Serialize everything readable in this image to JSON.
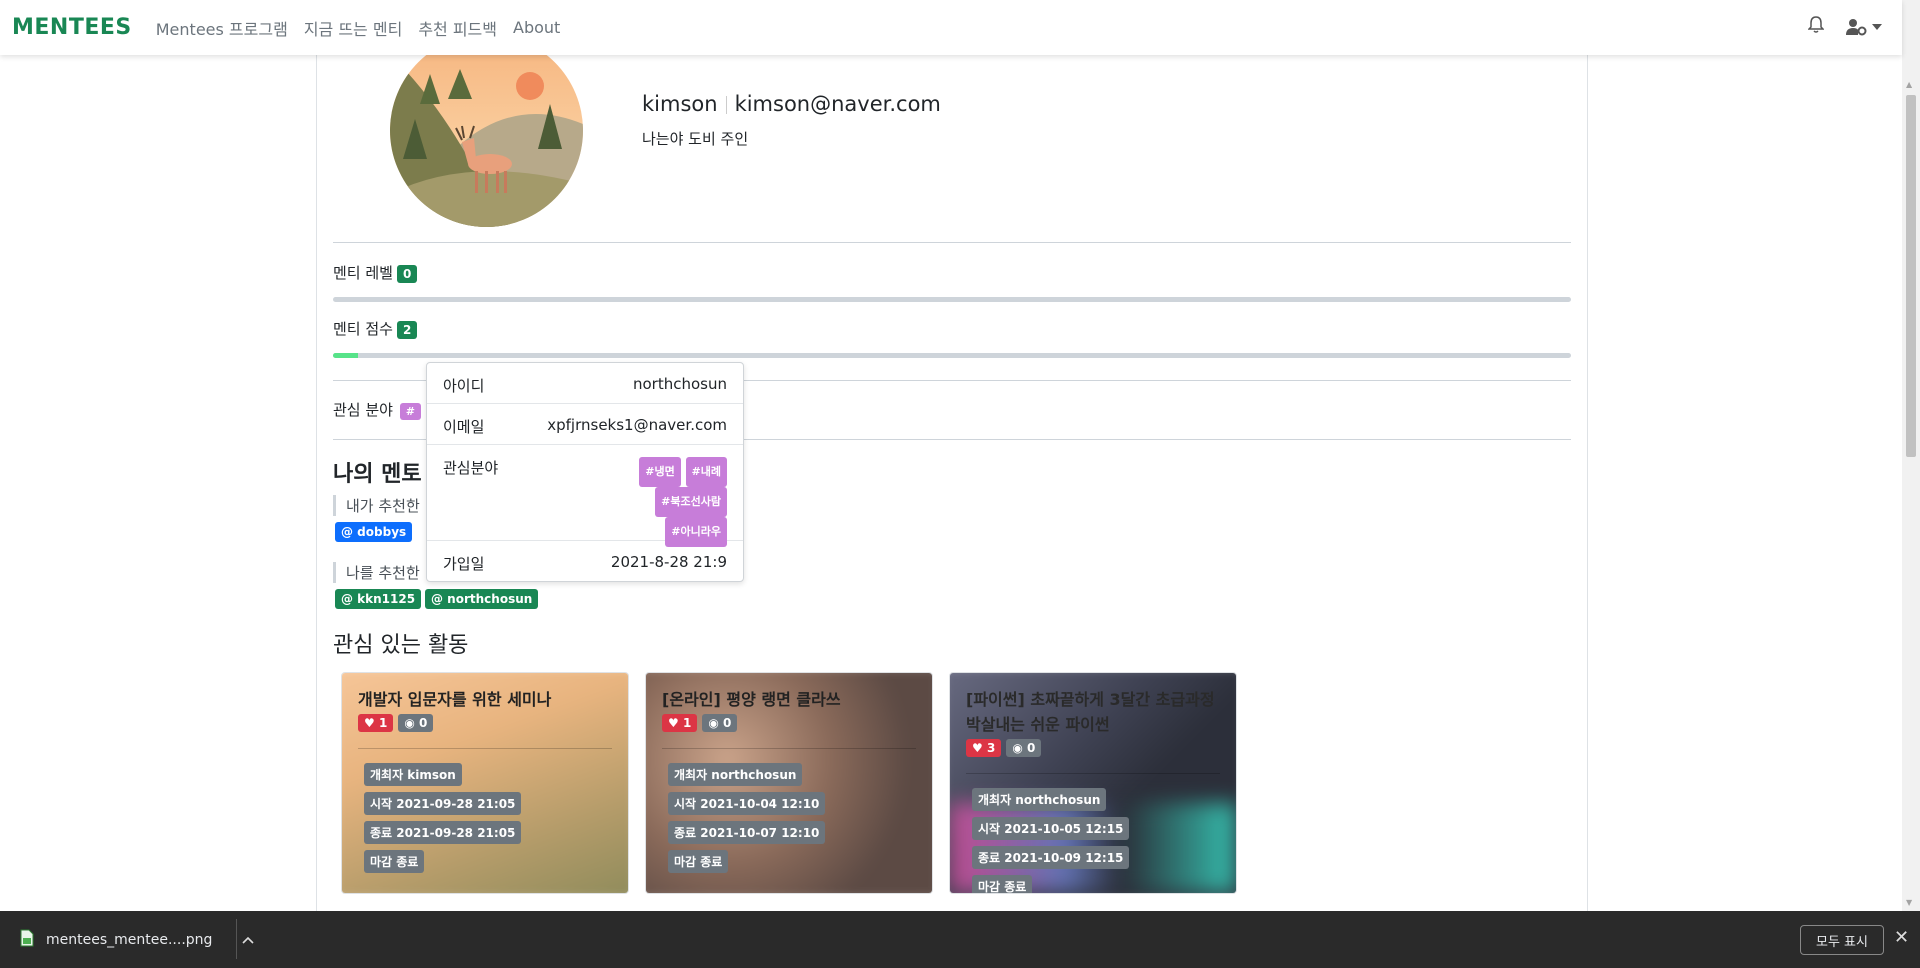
{
  "nav": {
    "brand": "MENTEES",
    "links": [
      "Mentees 프로그램",
      "지금 뜨는 멘티",
      "추천 피드백",
      "About"
    ]
  },
  "profile": {
    "username": "kimson",
    "email": "kimson@naver.com",
    "bio": "나는야 도비 주인"
  },
  "level": {
    "label": "멘티 레벨",
    "value": "0",
    "progress": 0
  },
  "score": {
    "label": "멘티 점수",
    "value": "2",
    "progress": 0.02
  },
  "interest": {
    "label": "관심 분야",
    "tag_visible": "#"
  },
  "mentors": {
    "title": "나의 멘토",
    "i_recommended_label": "내가 추천한",
    "i_recommended": [
      "@ dobbys"
    ],
    "recommended_me_label": "나를 추천한",
    "recommended_me": [
      "@ kkn1125",
      "@ northchosun"
    ]
  },
  "popover": {
    "id_label": "아이디",
    "id_value": "northchosun",
    "email_label": "이메일",
    "email_value": "xpfjrnseks1@naver.com",
    "interest_label": "관심분야",
    "tags": [
      "#냉면",
      "#내례",
      "#북조선사람",
      "#아니라우"
    ],
    "joined_label": "가입일",
    "joined_value": "2021-8-28 21:9"
  },
  "activities": {
    "title": "관심 있는 활동",
    "cards": [
      {
        "title": "개발자 입문자를 위한 세미나",
        "likes": "1",
        "views": "0",
        "host": "개최자 kimson",
        "start": "시작 2021-09-28 21:05",
        "end": "종료 2021-09-28 21:05",
        "status": "마감 종료"
      },
      {
        "title": "[온라인] 평양 랭면 클라쓰",
        "likes": "1",
        "views": "0",
        "host": "개최자 northchosun",
        "start": "시작 2021-10-04 12:10",
        "end": "종료 2021-10-07 12:10",
        "status": "마감 종료"
      },
      {
        "title": "[파이썬] 초짜끝하게 3달간 초급과정 박살내는 쉬운 파이썬",
        "likes": "3",
        "views": "0",
        "host": "개최자 northchosun",
        "start": "시작 2021-10-05 12:15",
        "end": "종료 2021-10-09 12:15",
        "status": "마감 종료"
      }
    ]
  },
  "download_bar": {
    "file_name": "mentees_mentee....png",
    "show_all": "모두 표시"
  },
  "colors": {
    "brand": "#198754",
    "tag": "#c77dd9",
    "mention_blue": "#0d6efd",
    "mention_green": "#198754",
    "like": "#dc3545"
  }
}
